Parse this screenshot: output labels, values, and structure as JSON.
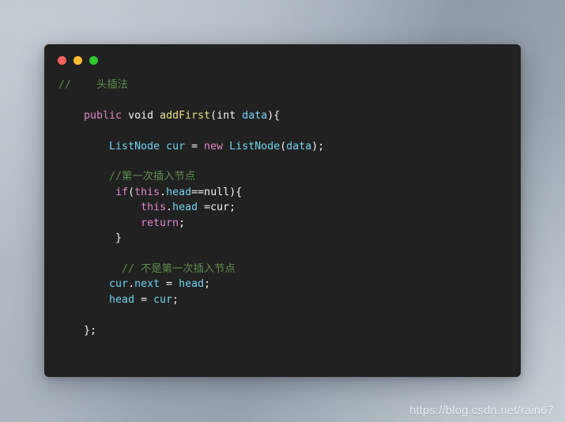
{
  "window": {
    "background_color": "#212121",
    "traffic_lights": [
      {
        "name": "close",
        "color": "#f9615c"
      },
      {
        "name": "minimize",
        "color": "#fbbd2e"
      },
      {
        "name": "zoom",
        "color": "#2fc92f"
      }
    ]
  },
  "palette": {
    "comment": "#5f8c4e",
    "keyword": "#dd87c4",
    "type": "#6fd3ef",
    "function": "#e2e08a",
    "parameter": "#7fd6f2",
    "plain": "#f2f2f2",
    "editor_bg": "#212121",
    "desktop_bg": "#9aa5b0"
  },
  "code": {
    "language": "java",
    "plain_text": "//    头插法\n\n    public void addFirst(int data){\n\n        ListNode cur = new ListNode(data);\n\n        //第一次插入节点\n         if(this.head==null){\n             this.head =cur;\n             return;\n         }\n\n          // 不是第一次插入节点\n        cur.next = head;\n        head = cur;\n\n    };",
    "lines": [
      {
        "id": 1,
        "text": "//    头插法",
        "tokens": [
          {
            "t": "//    头插法",
            "c": "comment"
          }
        ]
      },
      {
        "id": 2,
        "text": "",
        "tokens": []
      },
      {
        "id": 3,
        "text": "    public void addFirst(int data){",
        "tokens": [
          {
            "t": "    ",
            "c": "plain"
          },
          {
            "t": "public",
            "c": "keyword"
          },
          {
            "t": " void ",
            "c": "plain"
          },
          {
            "t": "addFirst",
            "c": "func"
          },
          {
            "t": "(",
            "c": "plain"
          },
          {
            "t": "int ",
            "c": "plain"
          },
          {
            "t": "data",
            "c": "param"
          },
          {
            "t": "){",
            "c": "plain"
          }
        ]
      },
      {
        "id": 4,
        "text": "",
        "tokens": []
      },
      {
        "id": 5,
        "text": "        ListNode cur = new ListNode(data);",
        "tokens": [
          {
            "t": "        ",
            "c": "plain"
          },
          {
            "t": "ListNode cur ",
            "c": "type"
          },
          {
            "t": "= ",
            "c": "plain"
          },
          {
            "t": "new",
            "c": "keyword"
          },
          {
            "t": " ",
            "c": "plain"
          },
          {
            "t": "ListNode",
            "c": "type"
          },
          {
            "t": "(",
            "c": "plain"
          },
          {
            "t": "data",
            "c": "param"
          },
          {
            "t": ");",
            "c": "plain"
          }
        ]
      },
      {
        "id": 6,
        "text": "",
        "tokens": []
      },
      {
        "id": 7,
        "text": "        //第一次插入节点",
        "tokens": [
          {
            "t": "        ",
            "c": "plain"
          },
          {
            "t": "//第一次插入节点",
            "c": "comment"
          }
        ]
      },
      {
        "id": 8,
        "text": "         if(this.head==null){",
        "tokens": [
          {
            "t": "         ",
            "c": "plain"
          },
          {
            "t": "if",
            "c": "keyword"
          },
          {
            "t": "(",
            "c": "plain"
          },
          {
            "t": "this",
            "c": "keyword"
          },
          {
            "t": ".",
            "c": "plain"
          },
          {
            "t": "head",
            "c": "type"
          },
          {
            "t": "==null){",
            "c": "plain"
          }
        ]
      },
      {
        "id": 9,
        "text": "             this.head =cur;",
        "tokens": [
          {
            "t": "             ",
            "c": "plain"
          },
          {
            "t": "this",
            "c": "keyword"
          },
          {
            "t": ".",
            "c": "plain"
          },
          {
            "t": "head",
            "c": "type"
          },
          {
            "t": " =cur;",
            "c": "plain"
          }
        ]
      },
      {
        "id": 10,
        "text": "             return;",
        "tokens": [
          {
            "t": "             ",
            "c": "plain"
          },
          {
            "t": "return",
            "c": "keyword"
          },
          {
            "t": ";",
            "c": "plain"
          }
        ]
      },
      {
        "id": 11,
        "text": "         }",
        "tokens": [
          {
            "t": "         }",
            "c": "plain"
          }
        ]
      },
      {
        "id": 12,
        "text": "",
        "tokens": []
      },
      {
        "id": 13,
        "text": "          // 不是第一次插入节点",
        "tokens": [
          {
            "t": "          ",
            "c": "plain"
          },
          {
            "t": "// 不是第一次插入节点",
            "c": "comment"
          }
        ]
      },
      {
        "id": 14,
        "text": "        cur.next = head;",
        "tokens": [
          {
            "t": "        ",
            "c": "plain"
          },
          {
            "t": "cur",
            "c": "type"
          },
          {
            "t": ".",
            "c": "plain"
          },
          {
            "t": "next ",
            "c": "type"
          },
          {
            "t": "= ",
            "c": "plain"
          },
          {
            "t": "head",
            "c": "type"
          },
          {
            "t": ";",
            "c": "plain"
          }
        ]
      },
      {
        "id": 15,
        "text": "        head = cur;",
        "tokens": [
          {
            "t": "        ",
            "c": "plain"
          },
          {
            "t": "head ",
            "c": "type"
          },
          {
            "t": "= ",
            "c": "plain"
          },
          {
            "t": "cur",
            "c": "type"
          },
          {
            "t": ";",
            "c": "plain"
          }
        ]
      },
      {
        "id": 16,
        "text": "",
        "tokens": []
      },
      {
        "id": 17,
        "text": "    };",
        "tokens": [
          {
            "t": "    };",
            "c": "plain"
          }
        ]
      }
    ]
  },
  "watermark": {
    "text": "https://blog.csdn.net/rain67"
  }
}
